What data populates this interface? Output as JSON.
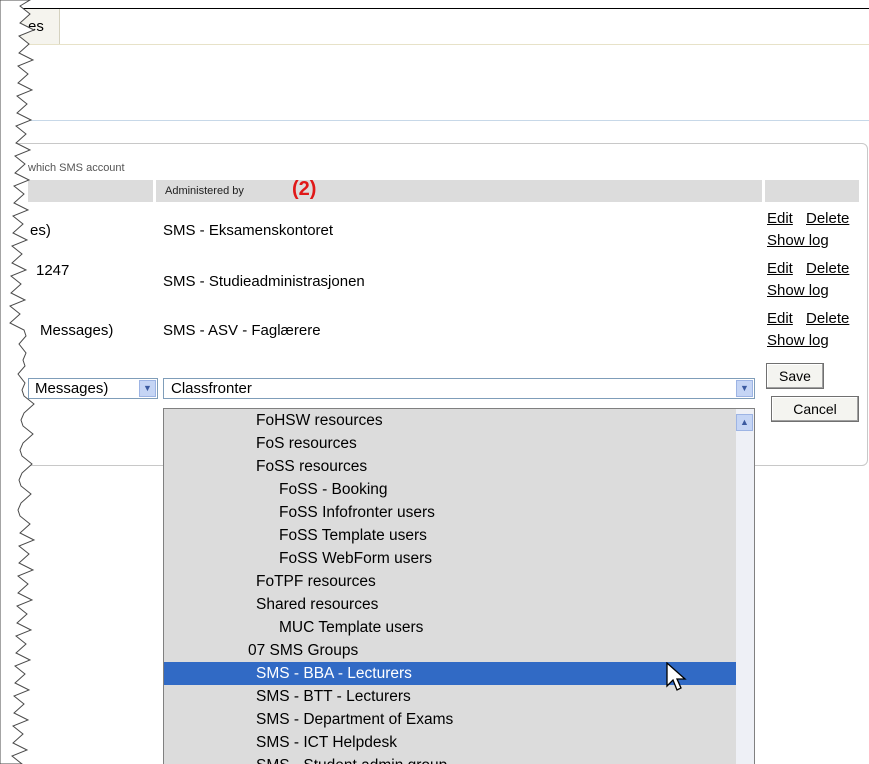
{
  "tabs": {
    "active_label": "es"
  },
  "panel": {
    "subtitle": "which SMS account"
  },
  "table": {
    "header_admin": "Administered by",
    "marker": "(2)",
    "rows": [
      {
        "left": "es)",
        "admin": "SMS - Eksamenskontoret",
        "edit": "Edit",
        "delete": "Delete",
        "log": "Show log"
      },
      {
        "left": "1247",
        "admin": "SMS - Studieadministrasjonen",
        "edit": "Edit",
        "delete": "Delete",
        "log": "Show log"
      },
      {
        "left": "Messages)",
        "admin": "SMS - ASV - Faglærere",
        "edit": "Edit",
        "delete": "Delete",
        "log": "Show log"
      }
    ]
  },
  "edit_row": {
    "left_select_value": "Messages)",
    "admin_select_value": "Classfronter",
    "save_label": "Save",
    "cancel_label": "Cancel"
  },
  "dropdown": {
    "options": [
      {
        "label": "FoHSW resources",
        "indent": 2
      },
      {
        "label": "FoS resources",
        "indent": 2
      },
      {
        "label": "FoSS resources",
        "indent": 2
      },
      {
        "label": "FoSS - Booking",
        "indent": 3
      },
      {
        "label": "FoSS Infofronter users",
        "indent": 3
      },
      {
        "label": "FoSS Template users",
        "indent": 3
      },
      {
        "label": "FoSS WebForm users",
        "indent": 3
      },
      {
        "label": "FoTPF resources",
        "indent": 2
      },
      {
        "label": "Shared resources",
        "indent": 2
      },
      {
        "label": "MUC Template users",
        "indent": 3
      },
      {
        "label": "07 SMS Groups",
        "indent": 1
      },
      {
        "label": "SMS - BBA - Lecturers",
        "indent": 2,
        "selected": true
      },
      {
        "label": "SMS - BTT - Lecturers",
        "indent": 2
      },
      {
        "label": "SMS - Department of Exams",
        "indent": 2
      },
      {
        "label": "SMS - ICT Helpdesk",
        "indent": 2
      },
      {
        "label": "SMS - Student admin group",
        "indent": 2
      }
    ]
  },
  "colors": {
    "highlight": "#316ac5",
    "marker": "#e01818",
    "header_bg": "#dcdcdc"
  }
}
